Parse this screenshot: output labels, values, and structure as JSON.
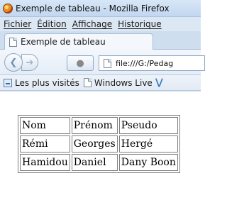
{
  "window": {
    "title": "Exemple de tableau - Mozilla Firefox"
  },
  "menu": {
    "items": [
      "Fichier",
      "Édition",
      "Affichage",
      "Historique"
    ]
  },
  "tab": {
    "label": "Exemple de tableau"
  },
  "nav": {
    "url": "file:///G:/Pedag"
  },
  "bookmarks": {
    "items": [
      "Les plus visités",
      "Windows Live"
    ]
  },
  "table": {
    "rows": [
      [
        "Nom",
        "Prénom",
        "Pseudo"
      ],
      [
        "Rémi",
        "Georges",
        "Hergé"
      ],
      [
        "Hamidou",
        "Daniel",
        "Dany Boon"
      ]
    ]
  }
}
